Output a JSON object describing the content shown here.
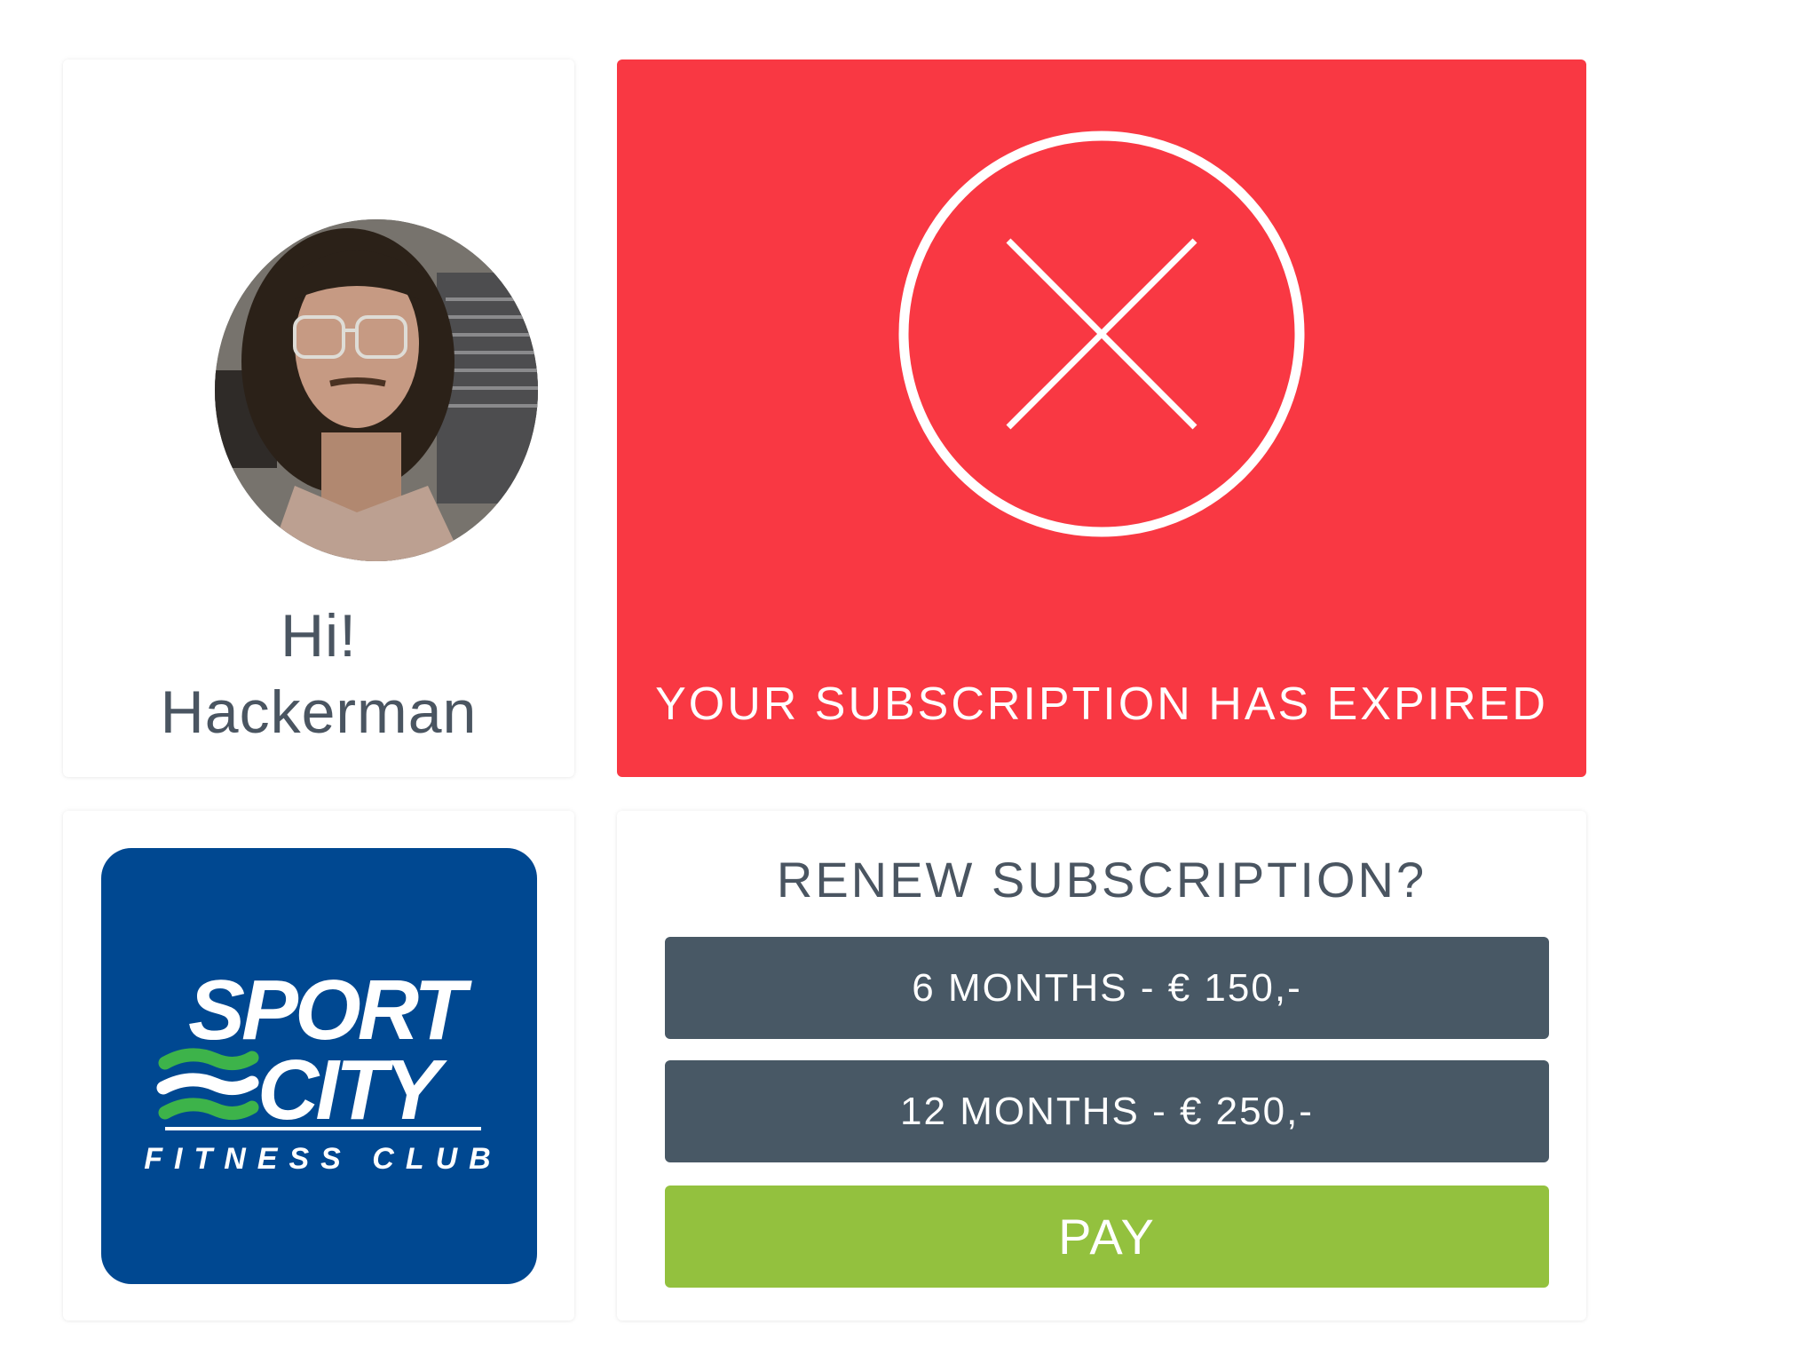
{
  "profile": {
    "greeting": "Hi!",
    "name": "Hackerman"
  },
  "status": {
    "message": "YOUR SUBSCRIPTION HAS EXPIRED",
    "icon": "close-circle-icon",
    "background_color": "#f93843"
  },
  "logo": {
    "line1": "SPORT",
    "line2": "CITY",
    "tagline": "FITNESS CLUB",
    "brand_color": "#004891",
    "wave_color": "#3db34a"
  },
  "renew": {
    "title": "RENEW SUBSCRIPTION?",
    "options": [
      {
        "label": "6 MONTHS - € 150,-"
      },
      {
        "label": "12 MONTHS - € 250,-"
      }
    ],
    "pay_label": "PAY",
    "option_color": "#485865",
    "pay_color": "#93c13e"
  }
}
